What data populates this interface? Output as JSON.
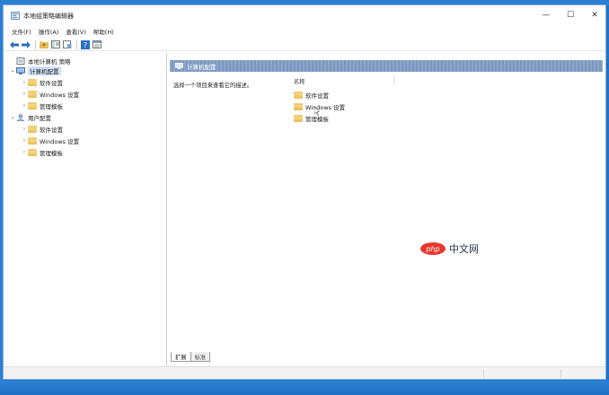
{
  "window": {
    "title": "本地组策略编辑器",
    "controls": {
      "minimize": "—",
      "maximize": "☐",
      "close": "✕"
    }
  },
  "menubar": {
    "items": [
      "文件(F)",
      "操作(A)",
      "查看(V)",
      "帮助(H)"
    ]
  },
  "toolbar": {
    "buttons": [
      "back-arrow-icon",
      "forward-arrow-icon",
      "up-folder-icon",
      "show-hide-tree-icon",
      "export-list-icon",
      "help-icon",
      "properties-icon"
    ]
  },
  "tree": {
    "root": "本地计算机 策略",
    "computer_config": "计算机配置",
    "computer_children": [
      "软件设置",
      "Windows 设置",
      "管理模板"
    ],
    "user_config": "用户配置",
    "user_children": [
      "软件设置",
      "Windows 设置",
      "管理模板"
    ]
  },
  "details": {
    "header": "计算机配置",
    "description": "选择一个项目来查看它的描述。",
    "column_name": "名称",
    "items": [
      "软件设置",
      "Windows 设置",
      "管理模板"
    ]
  },
  "tabs": [
    "扩展",
    "标准"
  ],
  "watermark": {
    "badge": "php",
    "text": "中文网"
  },
  "colors": {
    "header_band": "#7b97c0",
    "selection": "#cfe3f8",
    "folder": "#e9be55",
    "desktop": "#1e73c9"
  }
}
